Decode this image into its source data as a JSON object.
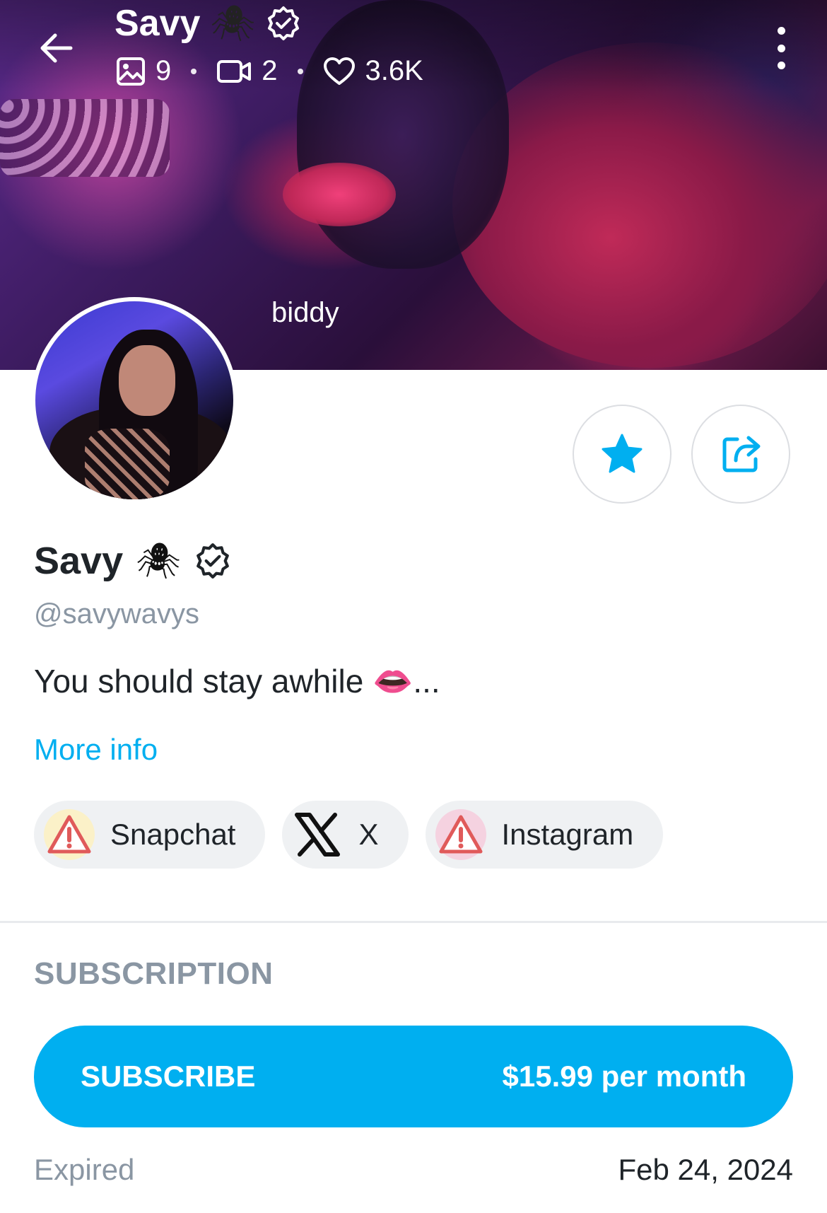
{
  "header": {
    "name": "Savy",
    "name_emoji": "🕷",
    "stats": {
      "photos": "9",
      "videos": "2",
      "likes": "3.6K"
    }
  },
  "cover": {
    "caption": "biddy"
  },
  "profile": {
    "name": "Savy",
    "name_emoji": "🕷",
    "handle": "@savywavys",
    "bio": "You should stay awhile 👄...",
    "more_info_label": "More info"
  },
  "socials": [
    {
      "label": "Snapchat",
      "icon": "warning-icon"
    },
    {
      "label": "X",
      "icon": "x-logo-icon"
    },
    {
      "label": "Instagram",
      "icon": "warning-icon"
    }
  ],
  "subscription": {
    "section_title": "SUBSCRIPTION",
    "button_label": "SUBSCRIBE",
    "price": "$15.99 per month",
    "status": "Expired",
    "date": "Feb 24, 2024"
  },
  "colors": {
    "accent": "#00aff0",
    "muted_text": "#8a96a3",
    "primary_text": "#1f2429"
  }
}
